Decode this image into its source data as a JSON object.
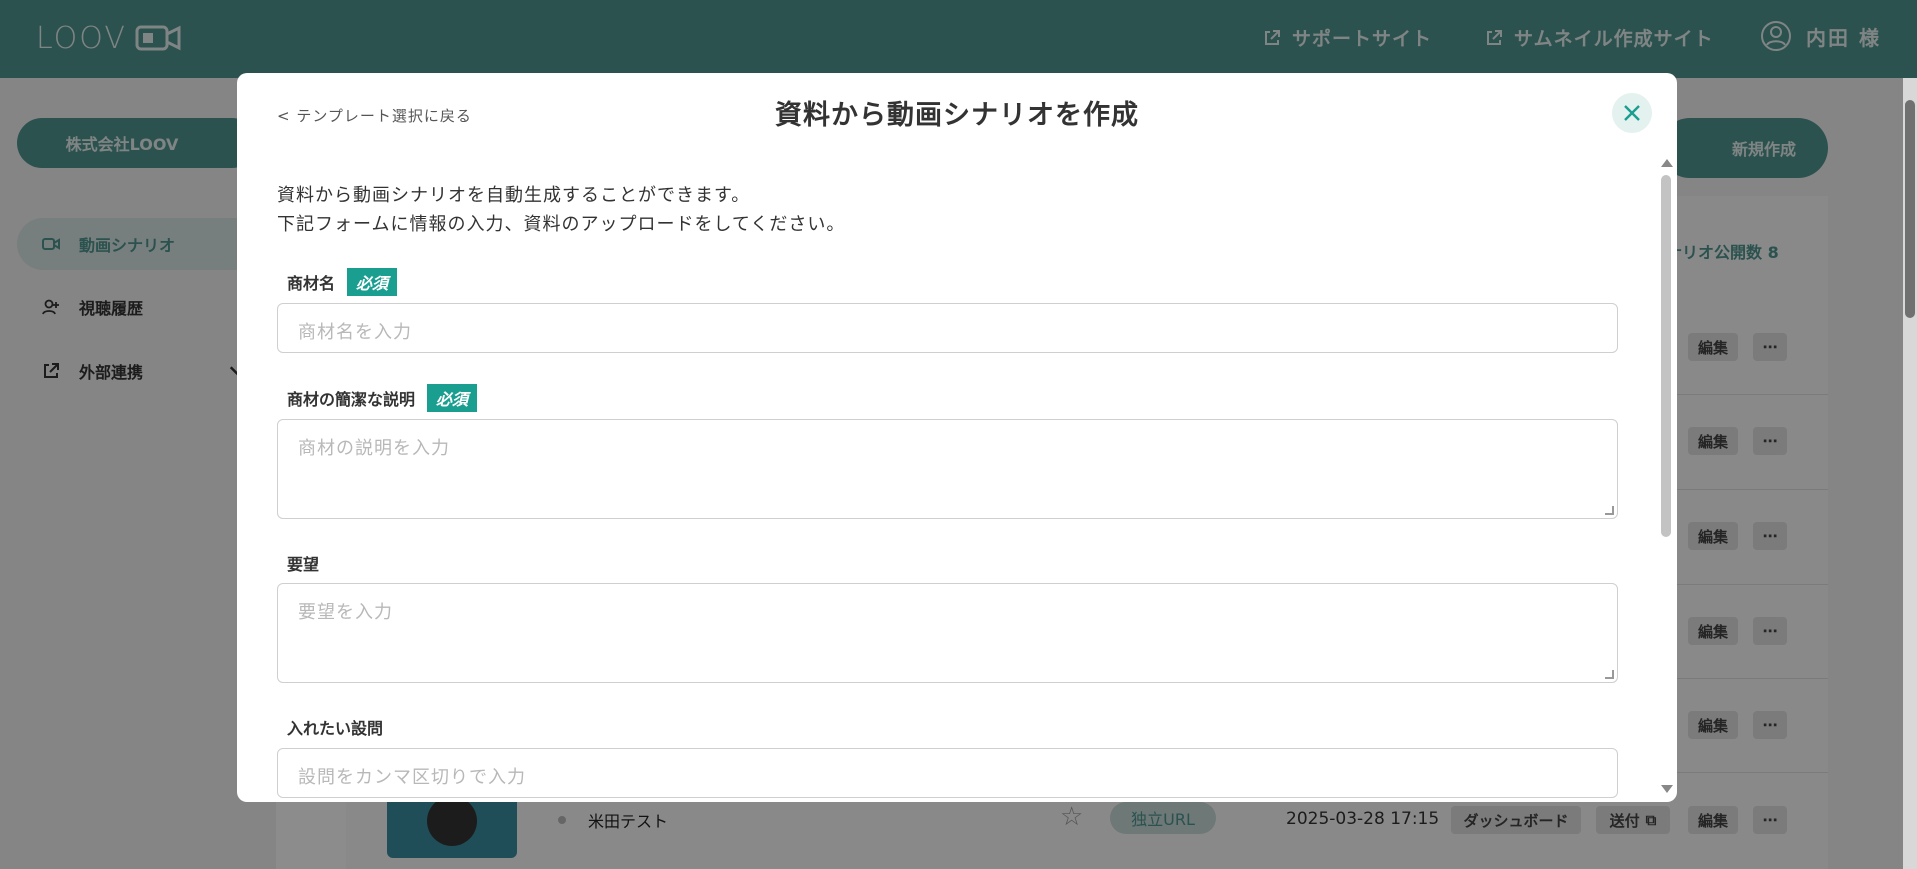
{
  "header": {
    "logo": "LOOV",
    "support_link": "サポートサイト",
    "thumbnail_link": "サムネイル作成サイト",
    "user_name": "内田 様"
  },
  "sidebar": {
    "company": "株式会社LOOV",
    "items": [
      {
        "label": "動画シナリオ",
        "icon": "video-icon",
        "active": true
      },
      {
        "label": "視聴履歴",
        "icon": "user-plus-icon"
      },
      {
        "label": "外部連携",
        "icon": "external-link-icon"
      }
    ]
  },
  "main": {
    "new_button": "新規作成",
    "public_count": "ナリオ公開数 8",
    "row_buttons": {
      "edit": "編集",
      "more": "⋯",
      "dashboard": "ダッシュボード",
      "send": "送付"
    },
    "last_row": {
      "title": "米田テスト",
      "badge": "独立URL",
      "date": "2025-03-28 17:15"
    }
  },
  "modal": {
    "back_link": "< テンプレート選択に戻る",
    "title": "資料から動画シナリオを作成",
    "intro_line1": "資料から動画シナリオを自動生成することができます。",
    "intro_line2": "下記フォームに情報の入力、資料のアップロードをしてください。",
    "required_badge": "必須",
    "fields": [
      {
        "label": "商材名",
        "placeholder": "商材名を入力",
        "required": true
      },
      {
        "label": "商材の簡潔な説明",
        "placeholder": "商材の説明を入力",
        "required": true
      },
      {
        "label": "要望",
        "placeholder": "要望を入力",
        "required": false
      },
      {
        "label": "入れたい設問",
        "placeholder": "設問をカンマ区切りで入力",
        "required": false
      }
    ]
  },
  "colors": {
    "brand": "#4f9690",
    "accent": "#1a9e90"
  }
}
